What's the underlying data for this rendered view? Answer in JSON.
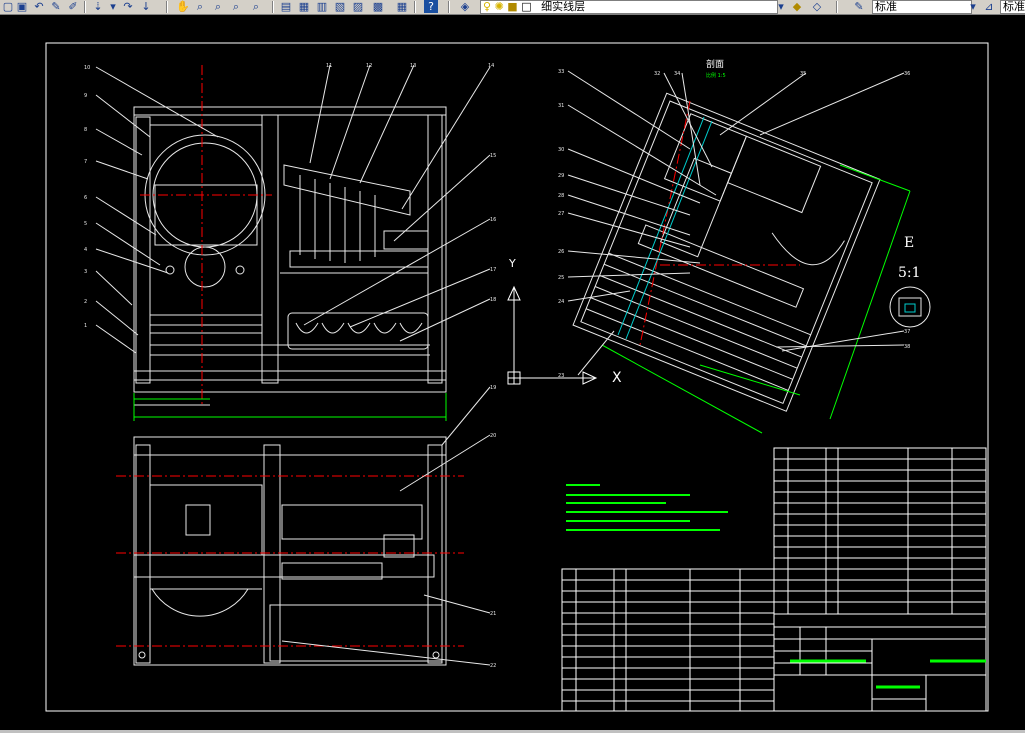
{
  "toolbar": {
    "layer_name": "细实线层",
    "text_style": "标准",
    "text_style_2": "标准"
  },
  "drawing": {
    "section_label": "剖面",
    "scale_note": "比例 1:5",
    "detail_letter": "E",
    "detail_scale": "5:1",
    "axis_y": "Y",
    "axis_x": "X",
    "colors": {
      "frame": "#ffffff",
      "annotation": "#00ff00",
      "center_line": "#ff0000",
      "geometry": "#e8e8e8",
      "background": "#000000"
    },
    "callouts_left": [
      "10",
      "9",
      "8",
      "7",
      "6",
      "5",
      "4",
      "3",
      "2",
      "1"
    ],
    "callouts_top": [
      "11",
      "12",
      "13",
      "14"
    ],
    "callouts_right_front": [
      "15",
      "16",
      "17",
      "18"
    ],
    "callouts_bottom_view": [
      "19",
      "20",
      "21",
      "22"
    ],
    "callouts_section_left": [
      "33",
      "31",
      "30",
      "29",
      "28",
      "27",
      "26",
      "25",
      "24",
      "23"
    ],
    "callouts_section_top": [
      "32",
      "34",
      "35",
      "36"
    ],
    "callouts_section_right": [
      "37",
      "38"
    ]
  }
}
